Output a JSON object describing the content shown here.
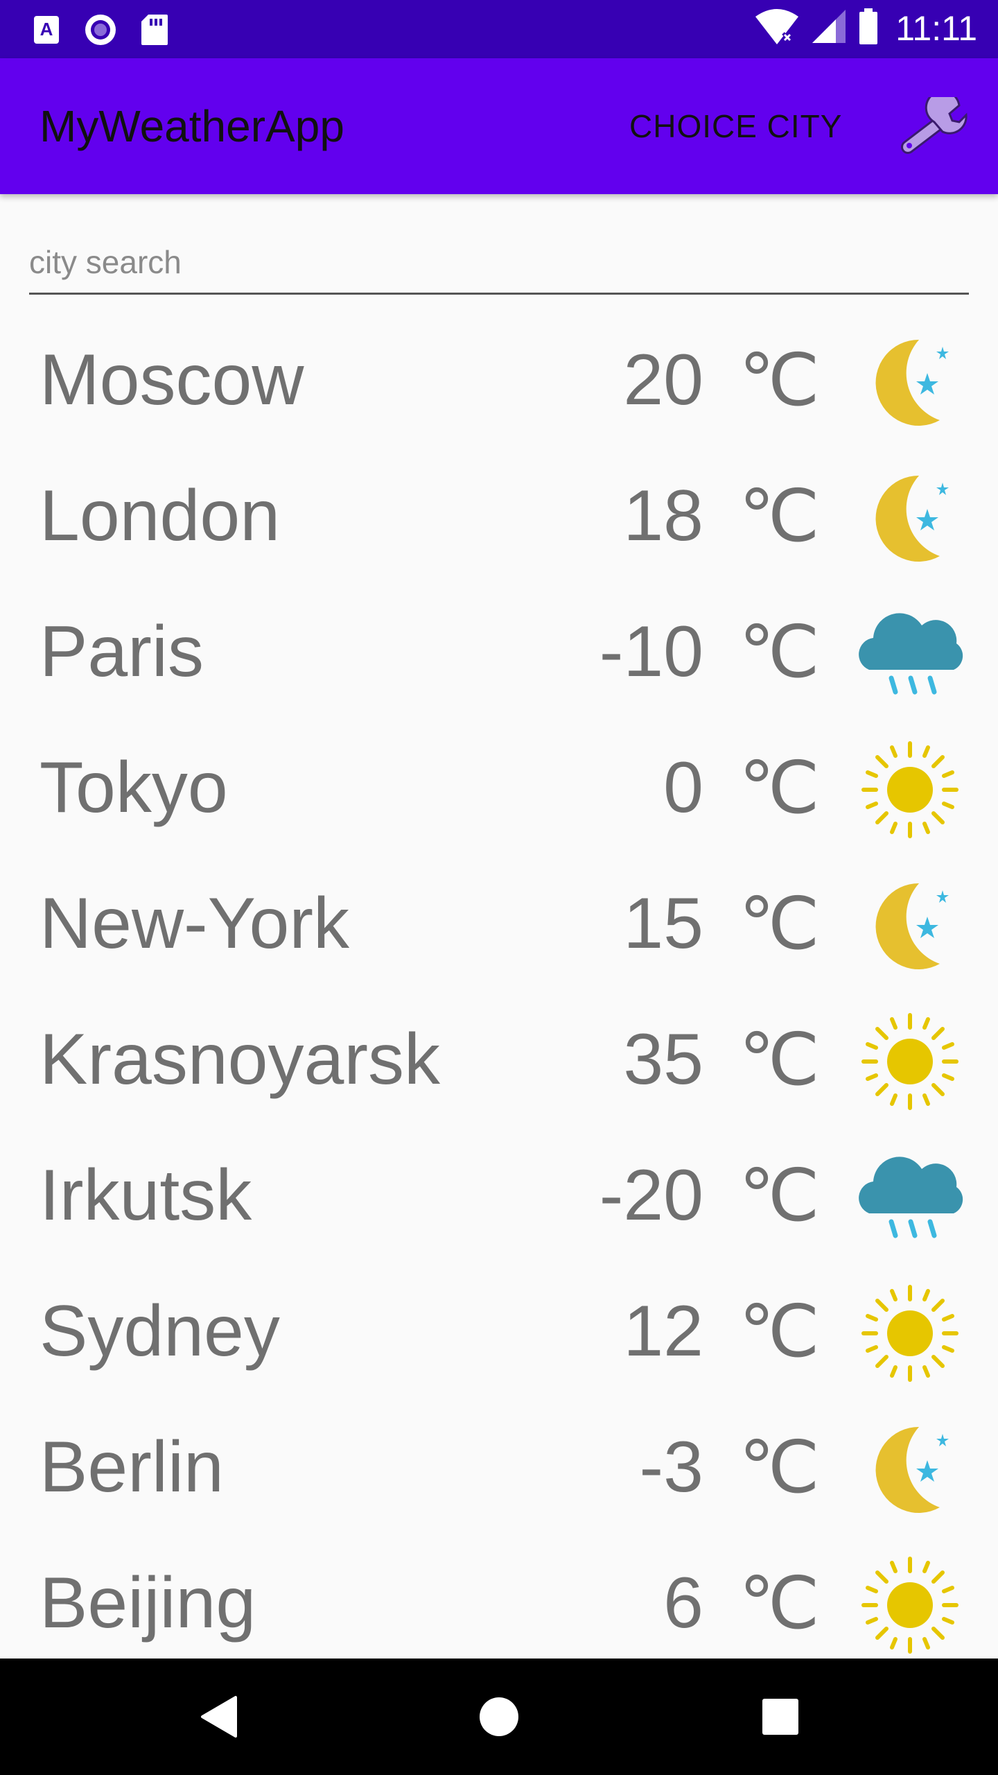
{
  "status_bar": {
    "time": "11:11",
    "left_icons": [
      "accessibility-icon",
      "record-icon",
      "sd-card-icon"
    ],
    "right_icons": [
      "wifi-icon",
      "signal-icon",
      "battery-icon"
    ]
  },
  "app_bar": {
    "title": "MyWeatherApp",
    "choice_city_label": "CHOICE CITY",
    "settings_icon": "wrench-icon",
    "background": "#6200ee"
  },
  "search": {
    "placeholder": "city search",
    "value": ""
  },
  "temp_unit": "℃",
  "cities": [
    {
      "name": "Moscow",
      "temp": "20",
      "weather": "night"
    },
    {
      "name": "London",
      "temp": "18",
      "weather": "night"
    },
    {
      "name": "Paris",
      "temp": "-10",
      "weather": "rain"
    },
    {
      "name": "Tokyo",
      "temp": "0",
      "weather": "sun"
    },
    {
      "name": "New-York",
      "temp": "15",
      "weather": "night"
    },
    {
      "name": "Krasnoyarsk",
      "temp": "35",
      "weather": "sun"
    },
    {
      "name": "Irkutsk",
      "temp": "-20",
      "weather": "rain"
    },
    {
      "name": "Sydney",
      "temp": "12",
      "weather": "sun"
    },
    {
      "name": "Berlin",
      "temp": "-3",
      "weather": "night"
    },
    {
      "name": "Beijing",
      "temp": "6",
      "weather": "sun"
    }
  ],
  "colors": {
    "status_bar": "#3700b3",
    "moon": "#e6c02f",
    "star": "#3db8e0",
    "cloud": "#3a93ad",
    "rain": "#3db8e0",
    "sun": "#e6c600"
  },
  "nav_bar": {
    "buttons": [
      "back-icon",
      "home-icon",
      "recents-icon"
    ]
  }
}
